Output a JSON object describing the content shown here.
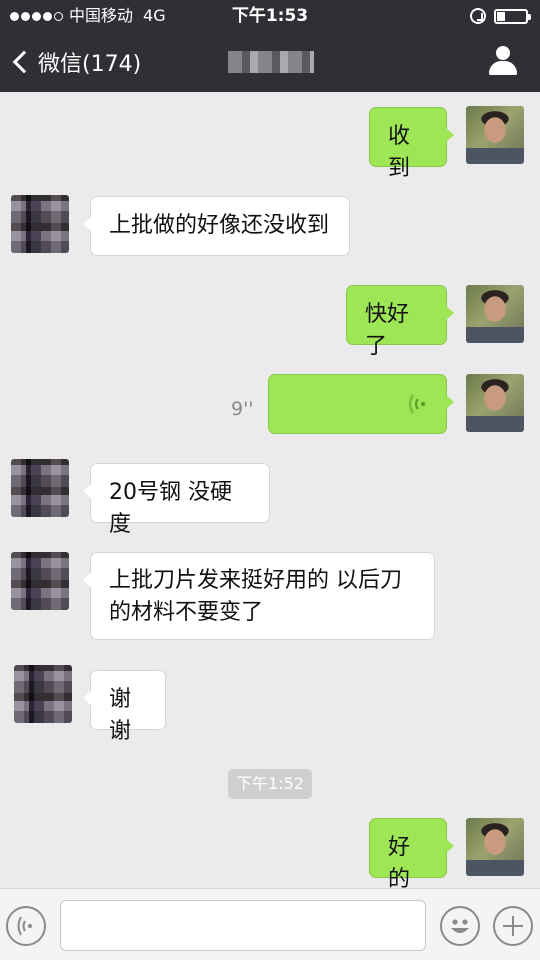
{
  "status_bar": {
    "carrier": "中国移动",
    "network": "4G",
    "time": "下午1:53",
    "signal_bars_filled": 4,
    "signal_bars_total": 5,
    "battery_level": 0.3
  },
  "nav": {
    "back_label": "微信(174)",
    "contact_name": ""
  },
  "messages": [
    {
      "from": "self",
      "kind": "text",
      "text": "收到"
    },
    {
      "from": "other",
      "kind": "text",
      "text": "上批做的好像还没收到"
    },
    {
      "from": "self",
      "kind": "text",
      "text": "快好了"
    },
    {
      "from": "self",
      "kind": "voice",
      "duration": "9''"
    },
    {
      "from": "other",
      "kind": "text",
      "text": "20号钢 没硬度"
    },
    {
      "from": "other",
      "kind": "text",
      "text": "上批刀片发来挺好用的 以后刀的材料不要变了"
    },
    {
      "from": "other",
      "kind": "text",
      "text": "谢谢"
    },
    {
      "kind": "timestamp",
      "text": "下午1:52"
    },
    {
      "from": "self",
      "kind": "text",
      "text": "好的"
    }
  ],
  "input": {
    "value": "",
    "placeholder": ""
  },
  "colors": {
    "outgoing_bubble": "#9fe657",
    "incoming_bubble": "#ffffff",
    "chat_background": "#ebebeb",
    "header": "#2f3035"
  },
  "icons": [
    "back-chevron",
    "profile-person",
    "voice-waves",
    "voice-input",
    "emoji-smiley",
    "plus"
  ]
}
